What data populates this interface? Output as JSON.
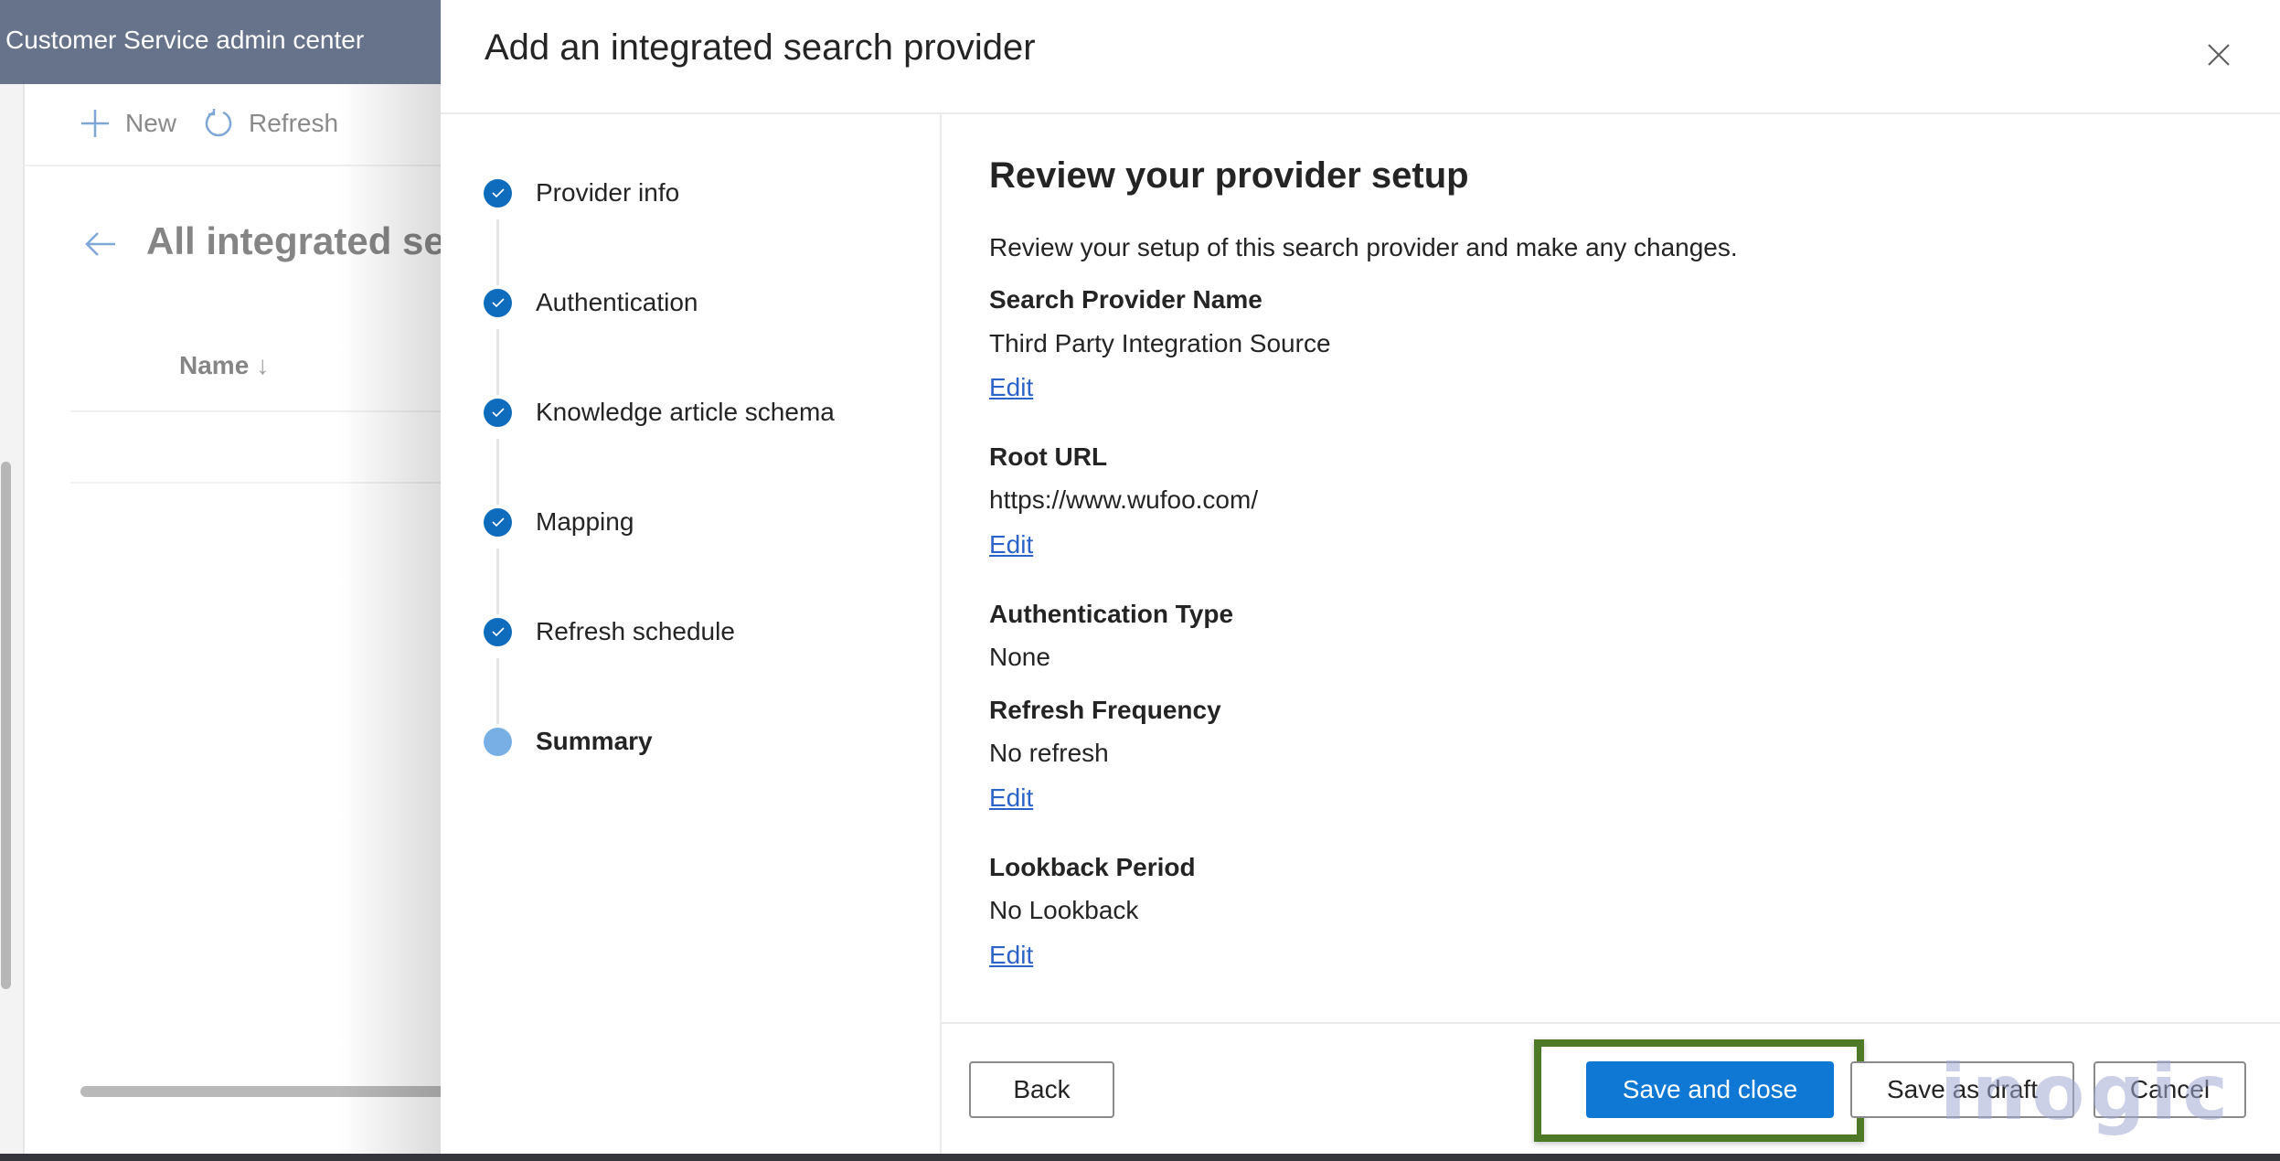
{
  "app": {
    "title": "Customer Service admin center",
    "commands": {
      "new_label": "New",
      "refresh_label": "Refresh"
    },
    "list_title": "All integrated sea",
    "column_header": "Name",
    "sort_indicator": "↓"
  },
  "panel": {
    "title": "Add an integrated search provider",
    "close_icon": "close-icon",
    "steps": [
      {
        "label": "Provider info",
        "status": "completed"
      },
      {
        "label": "Authentication",
        "status": "completed"
      },
      {
        "label": "Knowledge article schema",
        "status": "completed"
      },
      {
        "label": "Mapping",
        "status": "completed"
      },
      {
        "label": "Refresh schedule",
        "status": "completed"
      },
      {
        "label": "Summary",
        "status": "current"
      }
    ],
    "content": {
      "title": "Review your provider setup",
      "description": "Review your setup of this search provider and make any changes.",
      "fields": [
        {
          "label": "Search Provider Name",
          "value": "Third Party Integration Source",
          "edit": "Edit"
        },
        {
          "label": "Root URL",
          "value": "https://www.wufoo.com/",
          "edit": "Edit"
        },
        {
          "label": "Authentication Type",
          "value": "None"
        },
        {
          "label": "Refresh Frequency",
          "value": "No refresh",
          "edit": "Edit"
        },
        {
          "label": "Lookback Period",
          "value": "No Lookback",
          "edit": "Edit"
        }
      ]
    },
    "footer": {
      "back_label": "Back",
      "save_close_label": "Save and close",
      "save_draft_label": "Save as draft",
      "cancel_label": "Cancel"
    },
    "watermark": "inogic"
  },
  "colors": {
    "accent": "#0f78d4",
    "step_complete": "#0f6cbd",
    "step_current": "#78b0e6",
    "link": "#2b63c9",
    "highlight_border": "#4e7a27",
    "app_header": "#66738a"
  }
}
